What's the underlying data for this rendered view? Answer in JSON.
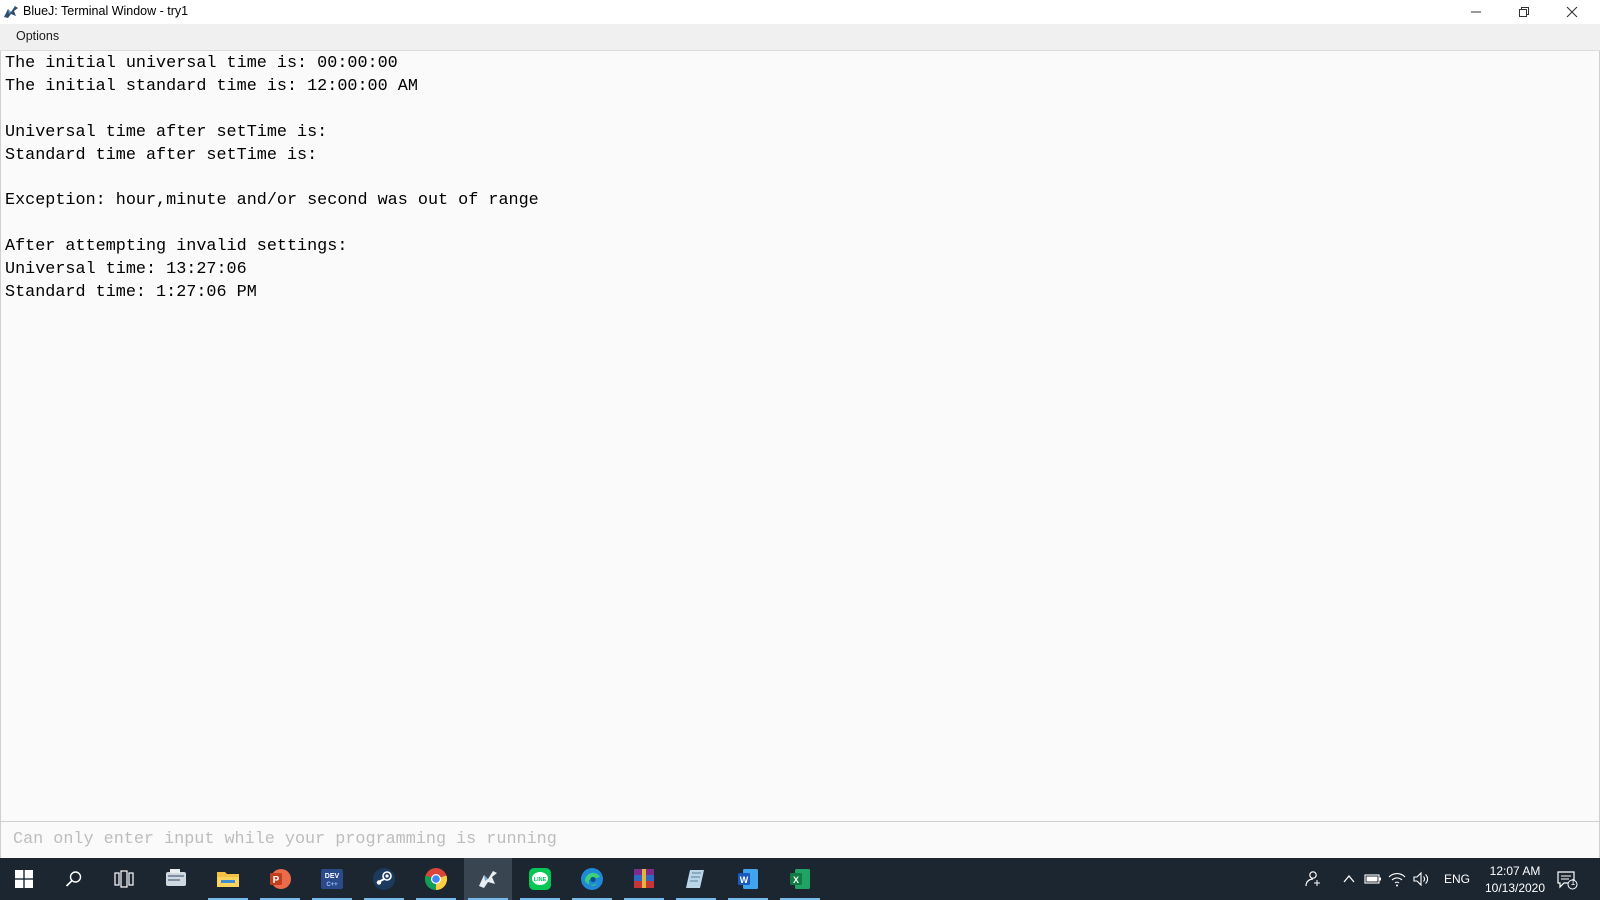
{
  "window": {
    "title": "BlueJ: Terminal Window - try1"
  },
  "menu": {
    "options_label": "Options"
  },
  "terminal": {
    "lines": [
      "The initial universal time is: 00:00:00",
      "The initial standard time is: 12:00:00 AM",
      "",
      "Universal time after setTime is:",
      "Standard time after setTime is:",
      "",
      "Exception: hour,minute and/or second was out of range",
      "",
      "After attempting invalid settings:",
      "Universal time: 13:27:06",
      "Standard time: 1:27:06 PM"
    ]
  },
  "input": {
    "placeholder": "Can only enter input while your programming is running",
    "value": ""
  },
  "taskbar": {
    "apps": [
      {
        "icon": "file-manager-icon",
        "active": false,
        "open": false
      },
      {
        "icon": "file-explorer-icon",
        "active": false,
        "open": true
      },
      {
        "icon": "powerpoint-icon",
        "active": false,
        "open": true
      },
      {
        "icon": "dev-cpp-icon",
        "active": false,
        "open": true
      },
      {
        "icon": "steam-icon",
        "active": false,
        "open": true
      },
      {
        "icon": "chrome-icon",
        "active": false,
        "open": true
      },
      {
        "icon": "bluej-icon",
        "active": true,
        "open": true
      },
      {
        "icon": "line-icon",
        "active": false,
        "open": true
      },
      {
        "icon": "edge-icon",
        "active": false,
        "open": true
      },
      {
        "icon": "winrar-icon",
        "active": false,
        "open": true
      },
      {
        "icon": "notes-app-icon",
        "active": false,
        "open": true
      },
      {
        "icon": "word-icon",
        "active": false,
        "open": true
      },
      {
        "icon": "excel-icon",
        "active": false,
        "open": true
      }
    ],
    "language": "ENG",
    "time": "12:07 AM",
    "date": "10/13/2020",
    "notification_count": "1"
  },
  "colors": {
    "taskbar_bg": "#1c2631",
    "taskbar_accent": "#76b9ed",
    "terminal_bg": "#fafafa"
  }
}
